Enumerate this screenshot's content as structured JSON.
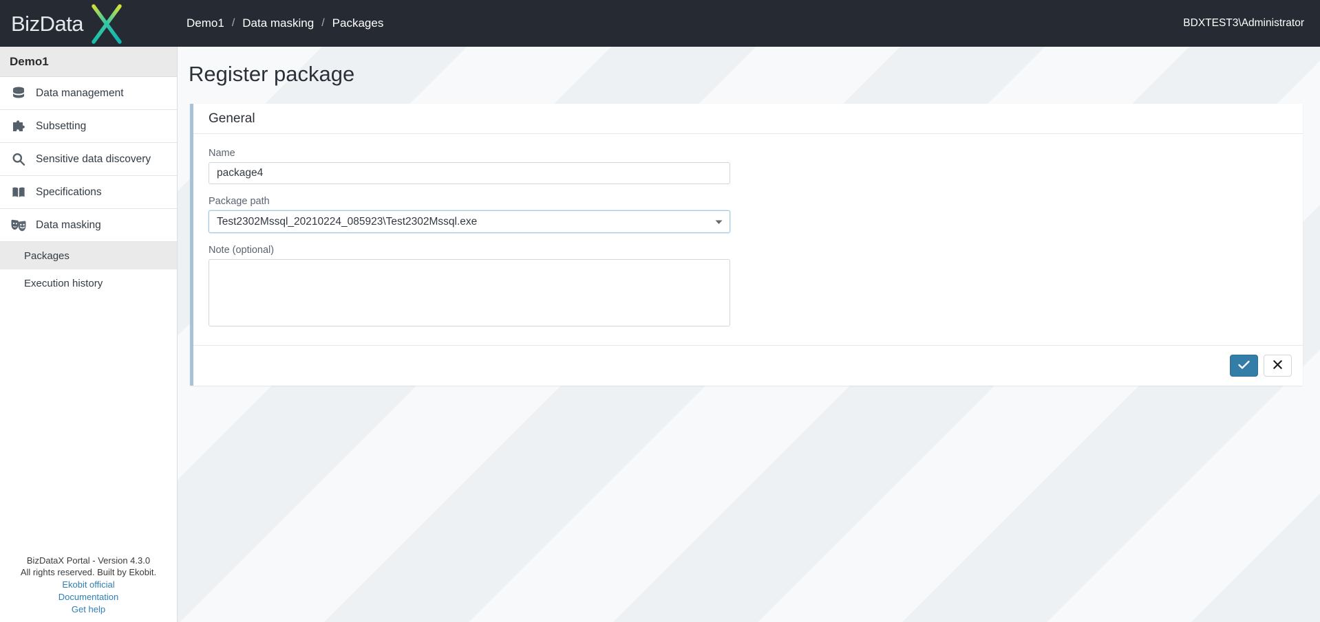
{
  "topbar": {
    "logo_text": "BizData",
    "logo_mark": "x-logo-icon",
    "breadcrumb": [
      "Demo1",
      "Data masking",
      "Packages"
    ],
    "breadcrumb_separator": "/",
    "user": "BDXTEST3\\Administrator",
    "background_color": "#252a33"
  },
  "sidebar": {
    "project_title": "Demo1",
    "items": [
      {
        "label": "Data management",
        "icon": "database-icon"
      },
      {
        "label": "Subsetting",
        "icon": "puzzle-piece-icon"
      },
      {
        "label": "Sensitive data discovery",
        "icon": "search-icon"
      },
      {
        "label": "Specifications",
        "icon": "open-book-icon"
      },
      {
        "label": "Data masking",
        "icon": "theater-masks-icon"
      }
    ],
    "subitems": [
      {
        "label": "Packages",
        "active": true
      },
      {
        "label": "Execution history",
        "active": false
      }
    ],
    "footer": {
      "version_line": "BizDataX Portal - Version 4.3.0",
      "rights_line": "All rights reserved. Built by Ekobit.",
      "links": [
        "Ekobit official",
        "Documentation",
        "Get help"
      ],
      "link_color": "#2f7fb5"
    }
  },
  "main": {
    "page_title": "Register package",
    "card": {
      "header": "General",
      "accent_color": "#a6c3d7",
      "fields": {
        "name": {
          "label": "Name",
          "value": "package4",
          "placeholder": ""
        },
        "package_path": {
          "label": "Package path",
          "value": "Test2302Mssql_20210224_085923\\Test2302Mssql.exe",
          "options": [
            "Test2302Mssql_20210224_085923\\Test2302Mssql.exe"
          ]
        },
        "note": {
          "label": "Note (optional)",
          "value": "",
          "placeholder": ""
        }
      },
      "actions": {
        "confirm_icon": "check-icon",
        "confirm_color": "#337da8",
        "cancel_icon": "close-icon"
      }
    }
  }
}
